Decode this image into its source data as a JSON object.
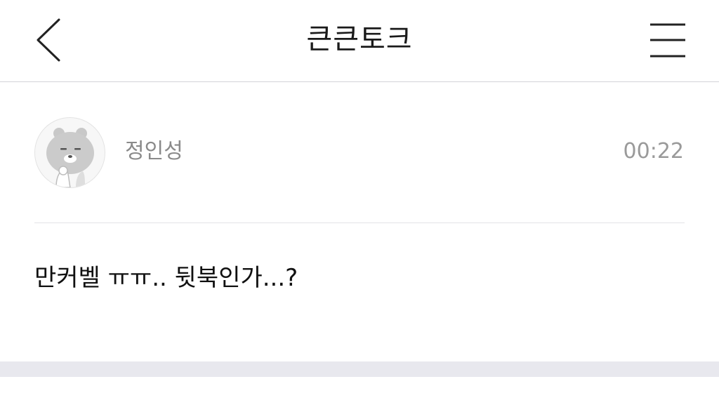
{
  "header": {
    "title": "큰큰토크",
    "back_icon": "chevron-left-icon",
    "menu_icon": "hamburger-menu-icon"
  },
  "post": {
    "author": "정인성",
    "time": "00:22",
    "avatar_icon": "bear-character-avatar",
    "message": "만커벨 ㅠㅠ.. 뒷북인가...?"
  },
  "colors": {
    "header_border": "#d4d4d8",
    "meta_text": "#8a8a8a",
    "bottom_band": "#e8e8ee"
  }
}
